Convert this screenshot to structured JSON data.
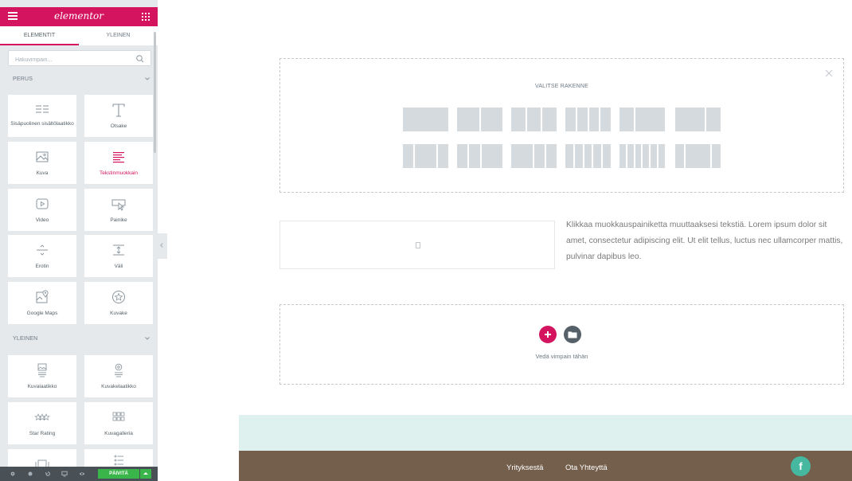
{
  "panel": {
    "brand": "elementor",
    "tabs": [
      {
        "label": "ELEMENTIT",
        "active": true
      },
      {
        "label": "YLEINEN",
        "active": false
      }
    ],
    "search": {
      "placeholder": "Hakuvimpain..."
    },
    "categories": [
      {
        "label": "PERUS"
      },
      {
        "label": "YLEINEN"
      }
    ],
    "widgets_basic": [
      {
        "label": "Sisäpuolinen sisältölaatikko",
        "icon": "inner-section-icon"
      },
      {
        "label": "Otsake",
        "icon": "heading-icon"
      },
      {
        "label": "Kuva",
        "icon": "image-icon"
      },
      {
        "label": "Tekstinmuokkain",
        "icon": "text-editor-icon"
      },
      {
        "label": "Video",
        "icon": "video-icon"
      },
      {
        "label": "Painike",
        "icon": "button-icon"
      },
      {
        "label": "Erotin",
        "icon": "divider-icon"
      },
      {
        "label": "Väli",
        "icon": "spacer-icon"
      },
      {
        "label": "Google Maps",
        "icon": "google-maps-icon"
      },
      {
        "label": "Kuvake",
        "icon": "star-icon"
      }
    ],
    "widgets_general": [
      {
        "label": "Kuvalaatikko",
        "icon": "image-box-icon"
      },
      {
        "label": "Kuvakelaatikko",
        "icon": "icon-box-icon"
      },
      {
        "label": "Star Rating",
        "icon": "star-rating-icon"
      },
      {
        "label": "Kuvagalleria",
        "icon": "gallery-icon"
      }
    ],
    "footer": {
      "update_label": "PÄIVITÄ"
    }
  },
  "canvas": {
    "structure_title": "VALITSE RAKENNE",
    "paragraph": "Klikkaa muokkauspainiketta muuttaaksesi tekstiä. Lorem ipsum dolor sit amet, consectetur adipiscing elit. Ut elit tellus, luctus nec ullamcorper mattis, pulvinar dapibus leo.",
    "drop_hint": "Vedä vimpain tähän",
    "footer_links": [
      "Yrityksestä",
      "Ota Yhteyttä"
    ],
    "facebook_glyph": "f"
  },
  "colors": {
    "accent": "#d5145f",
    "update": "#39b54a",
    "footer_brown": "#735f4c",
    "mint": "#dff1ee",
    "facebook": "#46b8a0"
  }
}
